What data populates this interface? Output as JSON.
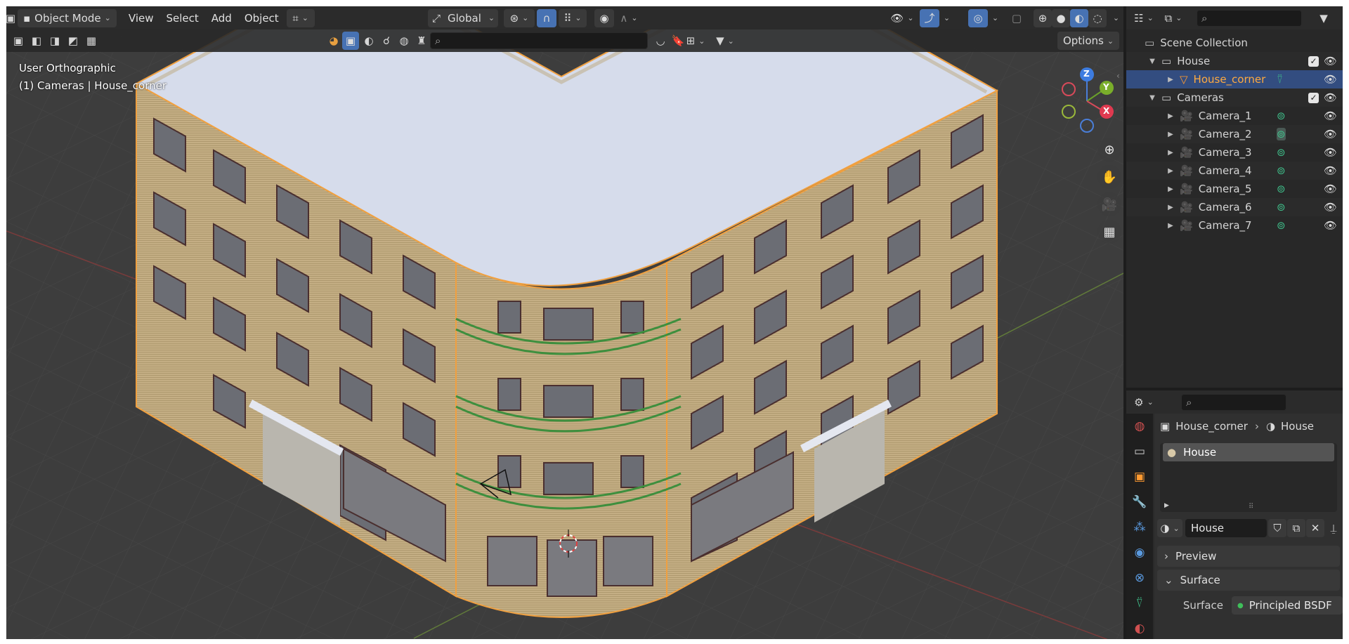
{
  "header": {
    "mode": "Object Mode",
    "menus": [
      "View",
      "Select",
      "Add",
      "Object"
    ],
    "orientation": "Global",
    "options": "Options"
  },
  "viewport": {
    "view_name": "User Orthographic",
    "collection_info": "(1) Cameras | House_corner",
    "axes": {
      "z": "Z",
      "y": "Y",
      "x": "X"
    }
  },
  "outliner": {
    "root": "Scene Collection",
    "rows": [
      {
        "name": "House"
      },
      {
        "name": "House_corner"
      },
      {
        "name": "Cameras"
      },
      {
        "name": "Camera_1"
      },
      {
        "name": "Camera_2"
      },
      {
        "name": "Camera_3"
      },
      {
        "name": "Camera_4"
      },
      {
        "name": "Camera_5"
      },
      {
        "name": "Camera_6"
      },
      {
        "name": "Camera_7"
      }
    ]
  },
  "properties": {
    "breadcrumb_object": "House_corner",
    "breadcrumb_material": "House",
    "slot_name": "House",
    "material_name": "House",
    "panels": {
      "preview": "Preview",
      "surface": "Surface"
    },
    "surface_label": "Surface",
    "surface_value": "Principled BSDF"
  },
  "colors": {
    "selected": "#334d80",
    "accent_blue": "#4772b3",
    "outline_orange": "#f0a040",
    "selected_text": "#ffaa40"
  }
}
